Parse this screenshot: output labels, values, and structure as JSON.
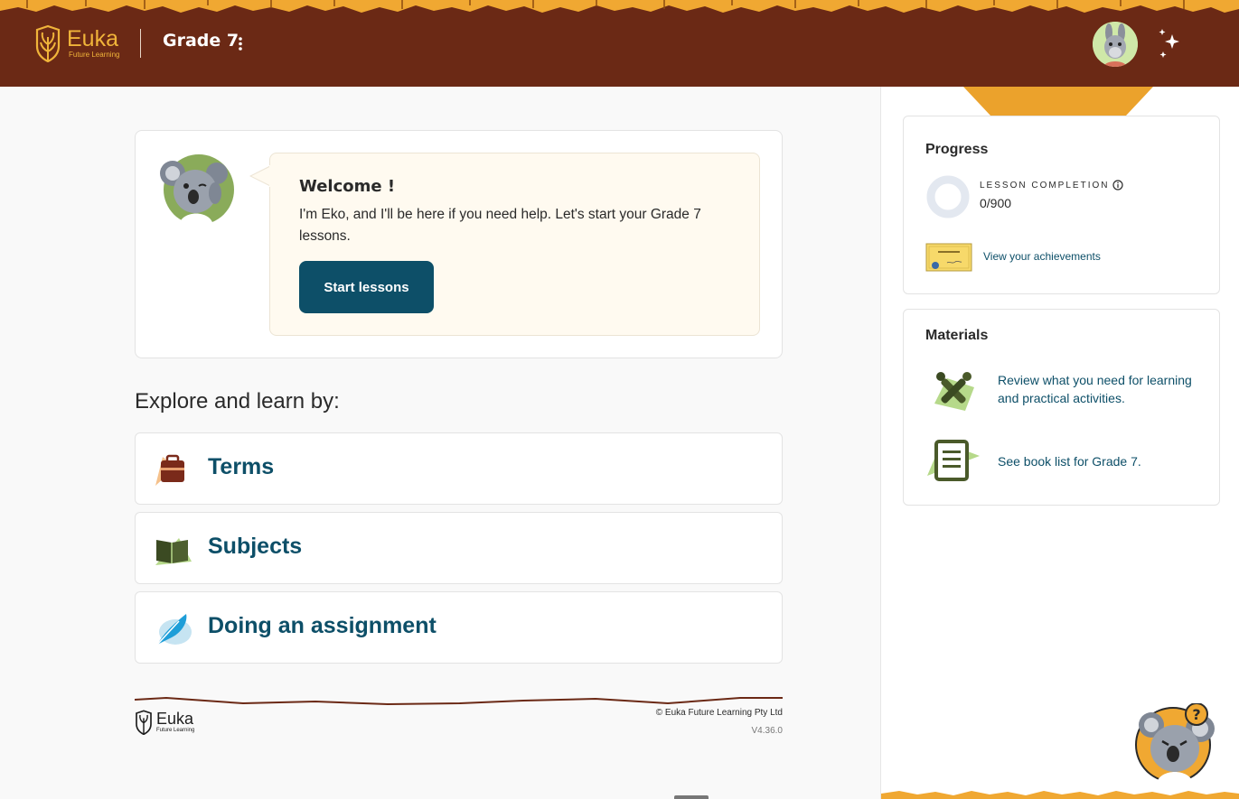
{
  "header": {
    "logo_name": "Euka",
    "logo_tagline": "Future Learning",
    "grade": "Grade 7"
  },
  "welcome": {
    "title": "Welcome !",
    "text": "I'm Eko, and I'll be here if you need help. Let's start your Grade 7 lessons.",
    "button_label": "Start lessons"
  },
  "explore": {
    "title": "Explore and learn by:",
    "items": [
      {
        "label": "Terms",
        "icon": "briefcase-icon"
      },
      {
        "label": "Subjects",
        "icon": "open-book-icon"
      },
      {
        "label": "Doing an assignment",
        "icon": "feather-icon"
      }
    ]
  },
  "progress": {
    "title": "Progress",
    "completion_label": "LESSON COMPLETION",
    "completion_value": "0/900",
    "completion_fraction": 0,
    "achievements_link": "View your achievements"
  },
  "materials": {
    "title": "Materials",
    "items": [
      {
        "text": "Review what you need for learning and practical activities.",
        "icon": "tools-icon"
      },
      {
        "text": "See book list for Grade 7.",
        "icon": "book-icon"
      }
    ]
  },
  "footer": {
    "logo_name": "Euka",
    "logo_tagline": "Future Learning",
    "copyright": "© Euka Future Learning Pty Ltd",
    "version": "V4.36.0"
  },
  "colors": {
    "header_bg": "#6b2915",
    "accent_orange": "#f0a832",
    "primary_teal": "#0d4f68",
    "page_bg": "#f9f9f9"
  }
}
